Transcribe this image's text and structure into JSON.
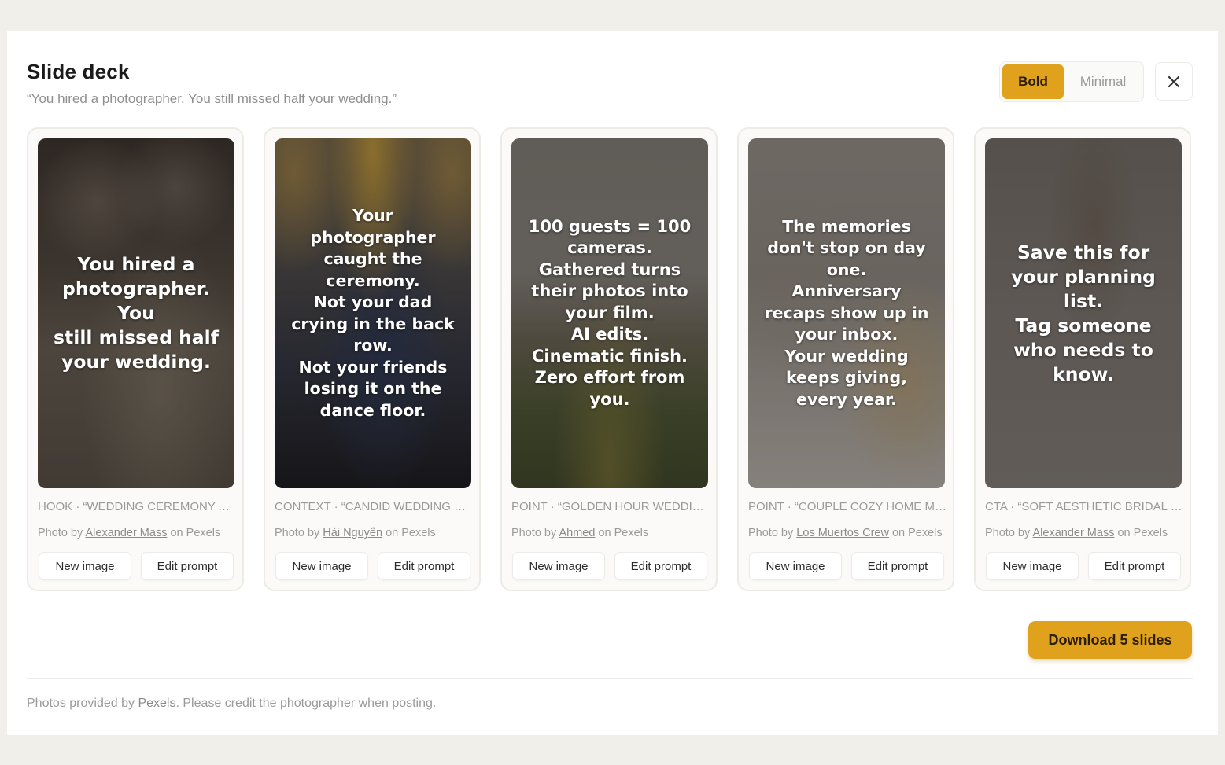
{
  "header": {
    "title": "Slide deck",
    "subtitle": "“You hired a photographer. You still missed half your wedding.”"
  },
  "style_toggle": {
    "options": [
      "Bold",
      "Minimal"
    ],
    "selected": "Bold"
  },
  "close_icon": "close-icon",
  "slides": [
    {
      "text": "You hired a\nphotographer.\nYou\nstill missed half\nyour wedding.",
      "caption": "HOOK · “WEDDING CEREMONY AUDIENCE”",
      "credit_prefix": "Photo by",
      "photographer": "Alexander Mass",
      "credit_suffix": "on Pexels",
      "new_image_label": "New image",
      "edit_prompt_label": "Edit prompt"
    },
    {
      "text": "Your\nphotographer\ncaught the\nceremony.\nNot your dad\ncrying in the back\nrow.\nNot your friends\nlosing it on the\ndance floor.",
      "caption": "CONTEXT · “CANDID WEDDING MOMENT”",
      "credit_prefix": "Photo by",
      "photographer": "Hải Nguyễn",
      "credit_suffix": "on Pexels",
      "new_image_label": "New image",
      "edit_prompt_label": "Edit prompt"
    },
    {
      "text": "100 guests = 100\ncameras.\nGathered turns\ntheir photos into\nyour film.\nAI edits.\nCinematic finish.\nZero effort from\nyou.",
      "caption": "POINT · “GOLDEN HOUR WEDDING”",
      "credit_prefix": "Photo by",
      "photographer": "Ahmed",
      "credit_suffix": "on Pexels",
      "new_image_label": "New image",
      "edit_prompt_label": "Edit prompt"
    },
    {
      "text": "The memories\ndon't stop on day\none.\nAnniversary\nrecaps show up in\nyour inbox.\nYour wedding\nkeeps giving,\nevery year.",
      "caption": "POINT · “COUPLE COZY HOME MORNING”",
      "credit_prefix": "Photo by",
      "photographer": "Los Muertos Crew",
      "credit_suffix": "on Pexels",
      "new_image_label": "New image",
      "edit_prompt_label": "Edit prompt"
    },
    {
      "text": "Save this for\nyour planning\nlist.\nTag someone\nwho needs to\nknow.",
      "caption": "CTA · “SOFT AESTHETIC BRIDAL SHOES”",
      "credit_prefix": "Photo by",
      "photographer": "Alexander Mass",
      "credit_suffix": "on Pexels",
      "new_image_label": "New image",
      "edit_prompt_label": "Edit prompt"
    }
  ],
  "download_label": "Download 5 slides",
  "footer": {
    "prefix": "Photos provided by",
    "link": "Pexels",
    "suffix": ". Please credit the photographer when posting."
  },
  "colors": {
    "accent": "#e0a21d",
    "page_background": "#f1efe9"
  }
}
